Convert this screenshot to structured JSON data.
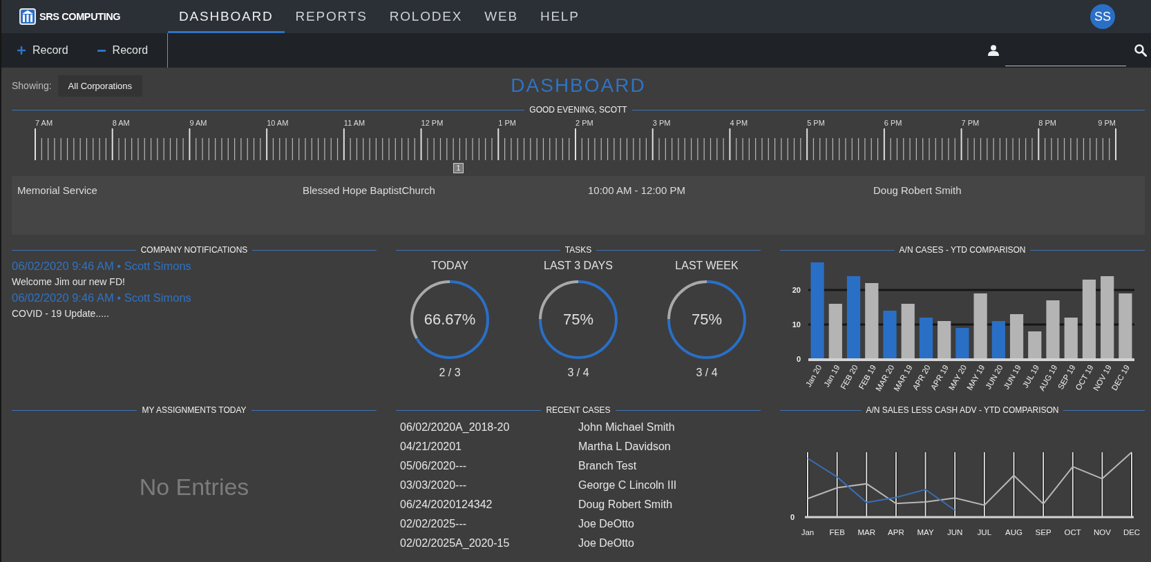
{
  "top_nav": {
    "logo_text": "SRS COMPUTING",
    "tabs": [
      {
        "label": "DASHBOARD",
        "selected": true
      },
      {
        "label": "REPORTS",
        "selected": false
      },
      {
        "label": "ROLODEX",
        "selected": false
      },
      {
        "label": "WEB",
        "selected": false
      },
      {
        "label": "HELP",
        "selected": false
      }
    ],
    "avatar_initials": "SS"
  },
  "toolbar": {
    "buttons": [
      {
        "kind": "add",
        "label": "Record"
      },
      {
        "kind": "remove",
        "label": "Record"
      }
    ]
  },
  "page_header": {
    "showing_label": "Showing:",
    "filter": "All Corporations",
    "title": "DASHBOARD"
  },
  "schedule": {
    "title": "GOOD EVENING, SCOTT",
    "hours": [
      "7 AM",
      "8 AM",
      "9 AM",
      "10 AM",
      "11 AM",
      "12 PM",
      "1 PM",
      "2 PM",
      "3 PM",
      "4 PM",
      "5 PM",
      "6 PM",
      "7 PM",
      "8 PM",
      "9 PM"
    ],
    "marker": "1",
    "event_details": [
      "Memorial Service",
      "Blessed Hope BaptistChurch",
      "10:00 AM - 12:00 PM",
      "Doug Robert Smith"
    ]
  },
  "notifications": {
    "title": "COMPANY NOTIFICATIONS",
    "items": [
      {
        "meta": "06/02/2020 9:46 AM • Scott Simons",
        "message": "Welcome Jim our new FD!"
      },
      {
        "meta": "06/02/2020 9:46 AM • Scott Simons",
        "message": "COVID - 19 Update....."
      }
    ]
  },
  "tasks": {
    "title": "TASKS",
    "gauges": [
      {
        "label": "TODAY",
        "percent": "66.67%",
        "level": 0.6667,
        "count": "2 / 3"
      },
      {
        "label": "LAST 3 DAYS",
        "percent": "75%",
        "level": 0.75,
        "count": "3 / 4"
      },
      {
        "label": "LAST WEEK",
        "percent": "75%",
        "level": 0.75,
        "count": "3 / 4"
      }
    ]
  },
  "cases_chart": {
    "chart_data": {
      "type": "bar",
      "title": "A/N CASES - YTD COMPARISON",
      "categories": [
        "Jan 20",
        "Jan 19",
        "FEB 20",
        "FEB 19",
        "MAR 20",
        "MAR 19",
        "APR 20",
        "APR 19",
        "MAY 20",
        "MAY 19",
        "JUN 20",
        "JUN 19",
        "JUL 19",
        "AUG 19",
        "SEP 19",
        "OCT 19",
        "NOV 19",
        "DEC 19"
      ],
      "series": [
        {
          "color": "#2a6fc6",
          "values": [
            28,
            null,
            24,
            null,
            14,
            null,
            12,
            null,
            9,
            null,
            11,
            null,
            null,
            null,
            null,
            null,
            null,
            null
          ]
        },
        {
          "color": "#b4b4b4",
          "values": [
            null,
            16,
            null,
            22,
            null,
            16,
            null,
            11,
            null,
            19,
            null,
            13,
            8,
            17,
            12,
            23,
            24,
            19
          ]
        }
      ],
      "ylim": [
        0,
        28
      ],
      "yticks": [
        0,
        10,
        20
      ],
      "grid": true
    }
  },
  "assignments": {
    "title": "MY ASSIGNMENTS TODAY",
    "empty_text": "No Entries"
  },
  "recent_cases": {
    "title": "RECENT CASES",
    "rows": [
      {
        "case_number": "06/02/2020A_2018-20",
        "name": "John Michael Smith"
      },
      {
        "case_number": "04/21/20201",
        "name": "Martha L Davidson"
      },
      {
        "case_number": "05/06/2020---",
        "name": "Branch Test"
      },
      {
        "case_number": "03/03/2020---",
        "name": "George C Lincoln III"
      },
      {
        "case_number": "06/24/2020124342",
        "name": "Doug Robert Smith"
      },
      {
        "case_number": "02/02/2025---",
        "name": "Joe DeOtto"
      },
      {
        "case_number": "02/02/2025A_2020-15",
        "name": "Joe DeOtto"
      }
    ]
  },
  "sales_chart": {
    "title": "A/N SALES LESS CASH ADV - YTD COMPARISON",
    "y_tick": "0",
    "months": [
      "Jan",
      "FEB",
      "MAR",
      "APR",
      "MAY",
      "JUN",
      "JUL",
      "AUG",
      "SEP",
      "OCT",
      "NOV",
      "DEC"
    ]
  }
}
